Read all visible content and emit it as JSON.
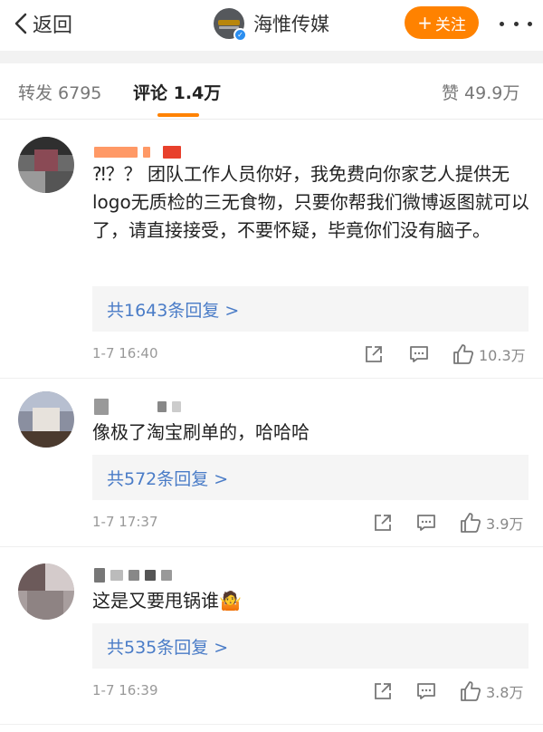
{
  "header": {
    "back_label": "返回",
    "title": "海惟传媒",
    "follow_label": "关注",
    "accent_color": "#ff8200"
  },
  "tabs": {
    "repost": "转发 6795",
    "comments": "评论 1.4万",
    "likes": "赞 49.9万"
  },
  "comments": [
    {
      "text": "⁈？？ 团队工作人员你好，我免费向你家艺人提供无logo无质检的三无食物，只要你帮我们微博返图就可以了，请直接接受，不要怀疑，毕竟你们没有脑子。",
      "replies": "共1643条回复 >",
      "time": "1-7 16:40",
      "likes": "10.3万"
    },
    {
      "text": "像极了淘宝刷单的，哈哈哈",
      "replies": "共572条回复 >",
      "time": "1-7 17:37",
      "likes": "3.9万"
    },
    {
      "text": "这是又要甩锅谁🤷",
      "replies": "共535条回复 >",
      "time": "1-7 16:39",
      "likes": "3.8万"
    }
  ],
  "icons": {
    "back": "chevron-left-icon",
    "more": "more-dots-icon",
    "share": "share-icon",
    "reply": "comment-icon",
    "like": "thumbs-up-icon",
    "verified": "verified-badge-icon"
  }
}
